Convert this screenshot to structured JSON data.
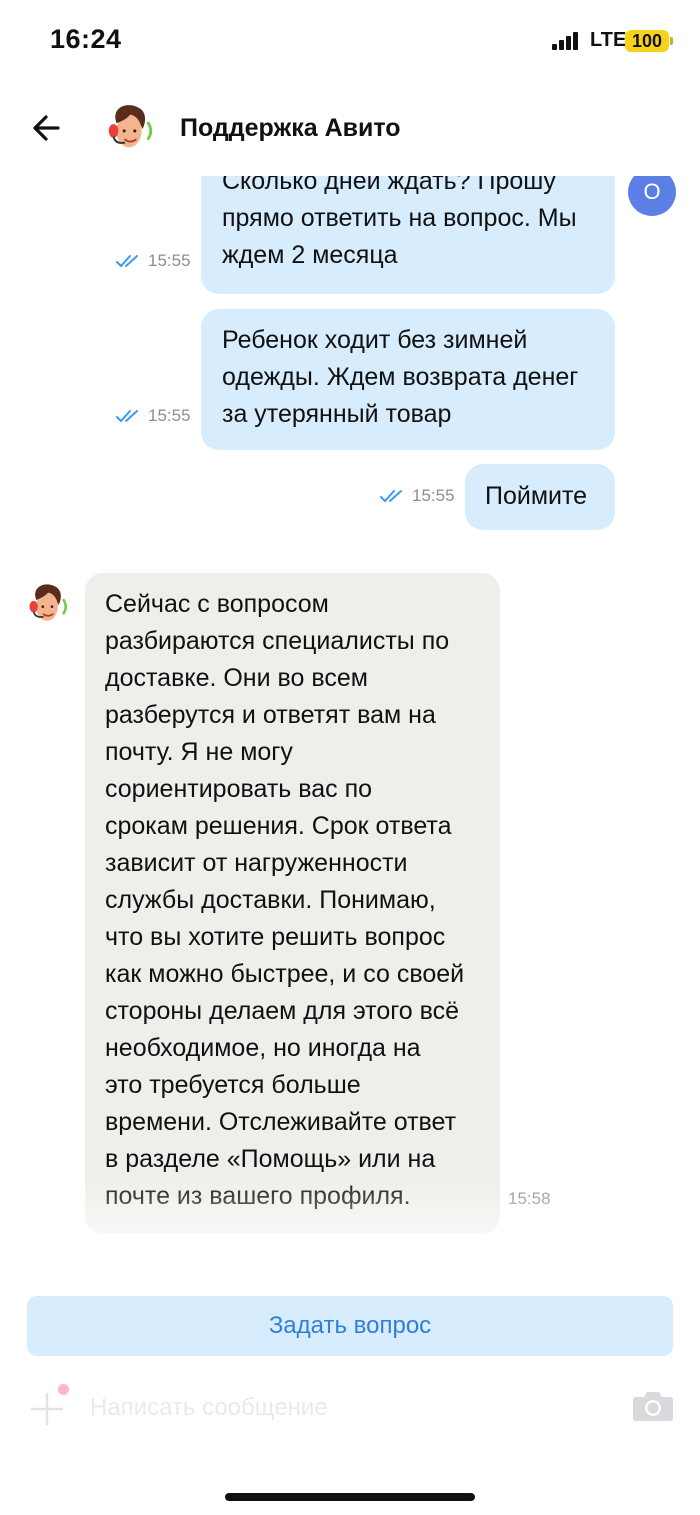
{
  "status_bar": {
    "time": "16:24",
    "network": "LTE",
    "battery": "100"
  },
  "header": {
    "title": "Поддержка Авито"
  },
  "messages": [
    {
      "direction": "out",
      "time": "15:55",
      "lines": [
        "Сколько дней ждать? Прошу",
        "прямо ответить на вопрос. Мы",
        "ждем 2 месяца"
      ]
    },
    {
      "direction": "out",
      "time": "15:55",
      "lines": [
        "Ребенок ходит без зимней",
        "одежды. Ждем возврата денег",
        "за утерянный товар"
      ]
    },
    {
      "direction": "out",
      "time": "15:55",
      "lines": [
        "Поймите"
      ]
    },
    {
      "direction": "in",
      "time": "15:58",
      "lines": [
        "Сейчас с вопросом",
        "разбираются специалисты по",
        "доставке. Они во всем",
        "разберутся и ответят вам на",
        "почту. Я не могу",
        "сориентировать вас по",
        "срокам решения. Срок ответа",
        "зависит от нагруженности",
        "службы доставки. Понимаю,",
        "что вы хотите решить вопрос",
        "как можно быстрее, и со своей",
        "стороны делаем для этого всё",
        "необходимое, но иногда на",
        "это требуется больше",
        "времени. Отслеживайте ответ",
        "в разделе «Помощь» или на",
        "почте из вашего профиля."
      ]
    }
  ],
  "user_avatar_letter": "О",
  "footer": {
    "ask_button": "Задать вопрос",
    "input_placeholder": "Написать сообщение"
  },
  "colors": {
    "outgoing_bubble": "#d7ecfd",
    "incoming_bubble": "#efeeea",
    "accent": "#2f7fd8",
    "read_ticks": "#3b9bf0"
  },
  "icons": [
    "back-arrow-icon",
    "support-agent-avatar",
    "double-check-icon",
    "plus-icon",
    "camera-icon"
  ]
}
